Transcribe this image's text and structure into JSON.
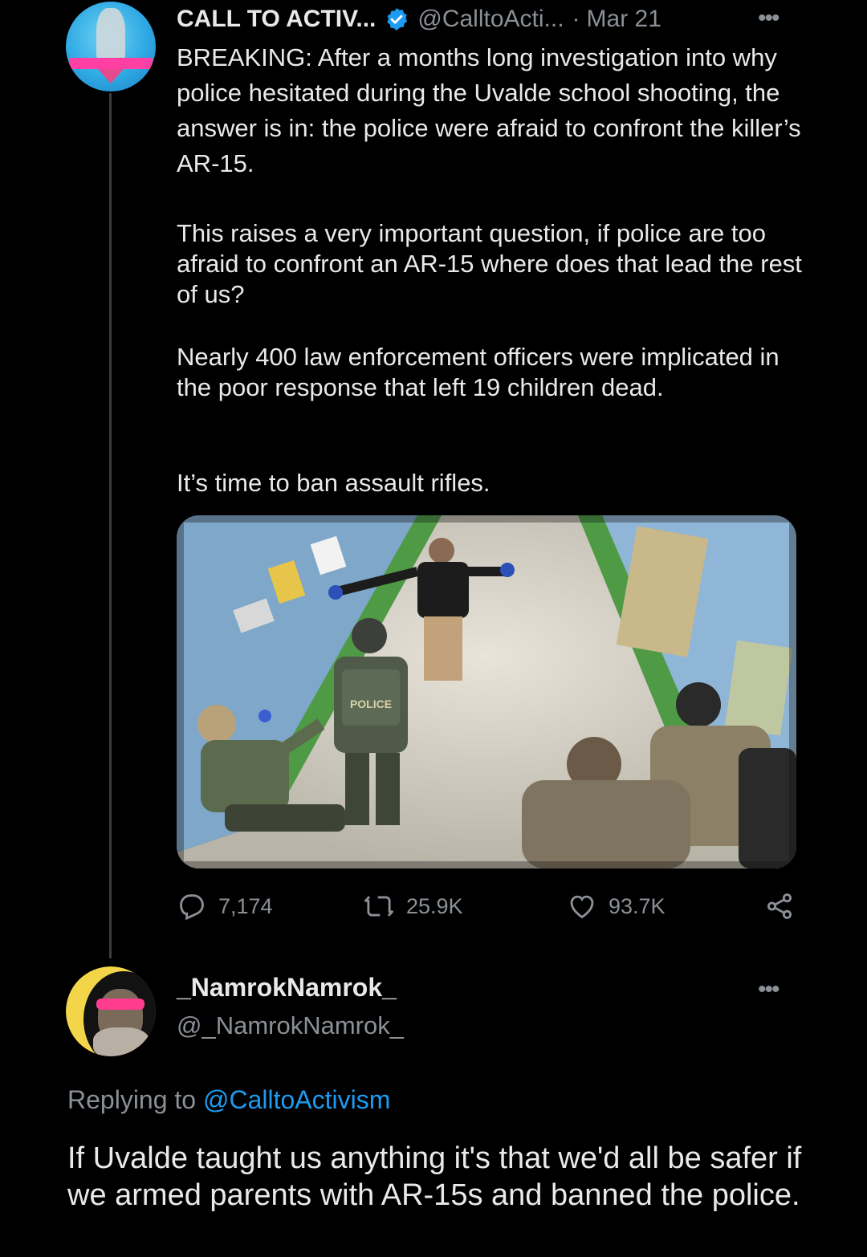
{
  "tweet": {
    "author": {
      "display_name": "CALL TO ACTIV...",
      "handle": "@CalltoActi...",
      "verified": true,
      "avatar_icon": "statue-of-liberty-avatar"
    },
    "separator": "·",
    "date": "Mar 21",
    "more_label": "•••",
    "paragraphs": [
      "BREAKING: After a months long investigation into why police hesitated during the Uvalde school shooting, the answer is in: the police were afraid to confront the killer’s AR-15.",
      "This raises a very important question, if police are too afraid to confront an AR-15 where does that lead the rest of us?",
      "Nearly 400 law enforcement officers were implicated in the poor response that left 19 children dead.",
      "It’s time to ban assault rifles."
    ],
    "media": {
      "description_icon": "hallway-surveillance-photo",
      "badge_text": "POLICE"
    },
    "stats": {
      "replies": "7,174",
      "retweets": "25.9K",
      "likes": "93.7K"
    }
  },
  "reply": {
    "author": {
      "display_name": "_NamrokNamrok_",
      "handle": "@_NamrokNamrok_",
      "avatar_icon": "hooded-figure-avatar"
    },
    "more_label": "•••",
    "replying_prefix": "Replying to",
    "replying_to": "@CalltoActivism",
    "text": "If Uvalde taught us anything it's that we'd all be safer if we armed parents with AR-15s and banned the police."
  },
  "colors": {
    "background": "#000000",
    "text": "#e7e9ea",
    "muted": "#8b9096",
    "accent": "#1d9bf0"
  }
}
